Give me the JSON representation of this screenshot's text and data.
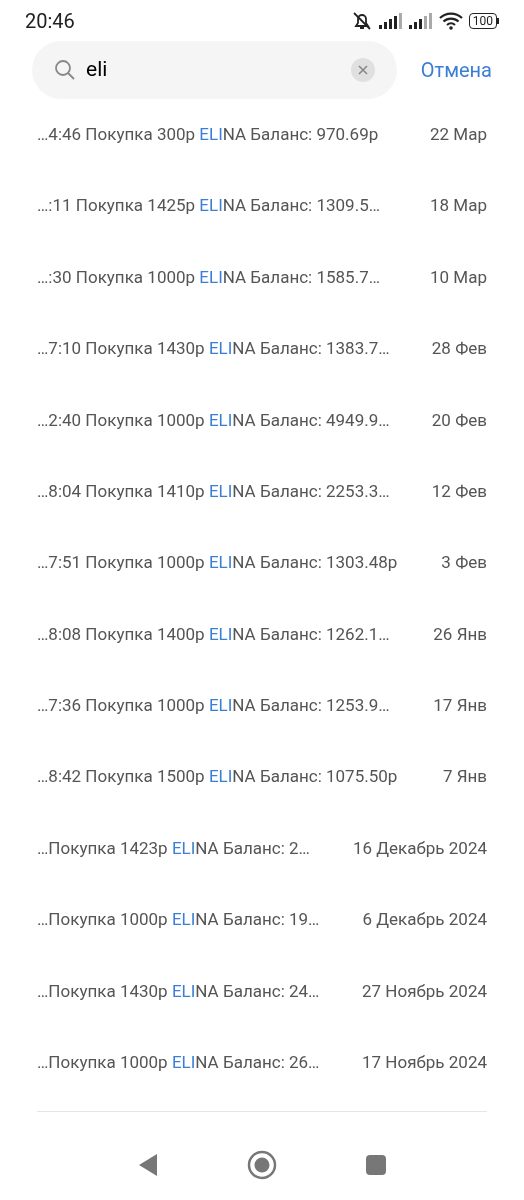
{
  "status_bar": {
    "time": "20:46",
    "battery": "100"
  },
  "search": {
    "value": "eli",
    "cancel": "Отмена"
  },
  "results": [
    {
      "before": "…4:46 Покупка 300р ",
      "match": "ELI",
      "after": "NA Баланс: 970.69р",
      "date": "22 Мар"
    },
    {
      "before": "…:11 Покупка 1425р ",
      "match": "ELI",
      "after": "NA Баланс: 1309.5…",
      "date": "18 Мар"
    },
    {
      "before": "…:30 Покупка 1000р ",
      "match": "ELI",
      "after": "NA Баланс: 1585.7…",
      "date": "10 Мар"
    },
    {
      "before": "…7:10 Покупка 1430р ",
      "match": "ELI",
      "after": "NA Баланс: 1383.7…",
      "date": "28 Фев"
    },
    {
      "before": "…2:40 Покупка 1000р ",
      "match": "ELI",
      "after": "NA Баланс: 4949.9…",
      "date": "20 Фев"
    },
    {
      "before": "…8:04 Покупка 1410р ",
      "match": "ELI",
      "after": "NA Баланс: 2253.3…",
      "date": "12 Фев"
    },
    {
      "before": "…7:51 Покупка 1000р ",
      "match": "ELI",
      "after": "NA Баланс: 1303.48р",
      "date": "3 Фев"
    },
    {
      "before": "…8:08 Покупка 1400р ",
      "match": "ELI",
      "after": "NA Баланс: 1262.1…",
      "date": "26 Янв"
    },
    {
      "before": "…7:36 Покупка 1000р ",
      "match": "ELI",
      "after": "NA Баланс: 1253.9…",
      "date": "17 Янв"
    },
    {
      "before": "…8:42 Покупка 1500р ",
      "match": "ELI",
      "after": "NA Баланс: 1075.50р",
      "date": "7 Янв"
    },
    {
      "before": "…Покупка 1423р ",
      "match": "ELI",
      "after": "NA Баланс: 2…",
      "date": "16 Декабрь 2024"
    },
    {
      "before": "…Покупка 1000р ",
      "match": "ELI",
      "after": "NA Баланс: 19…",
      "date": "6 Декабрь 2024"
    },
    {
      "before": "…Покупка 1430р ",
      "match": "ELI",
      "after": "NA Баланс: 24…",
      "date": "27 Ноябрь 2024"
    },
    {
      "before": "…Покупка 1000р ",
      "match": "ELI",
      "after": "NA Баланс: 26…",
      "date": "17 Ноябрь 2024"
    }
  ]
}
